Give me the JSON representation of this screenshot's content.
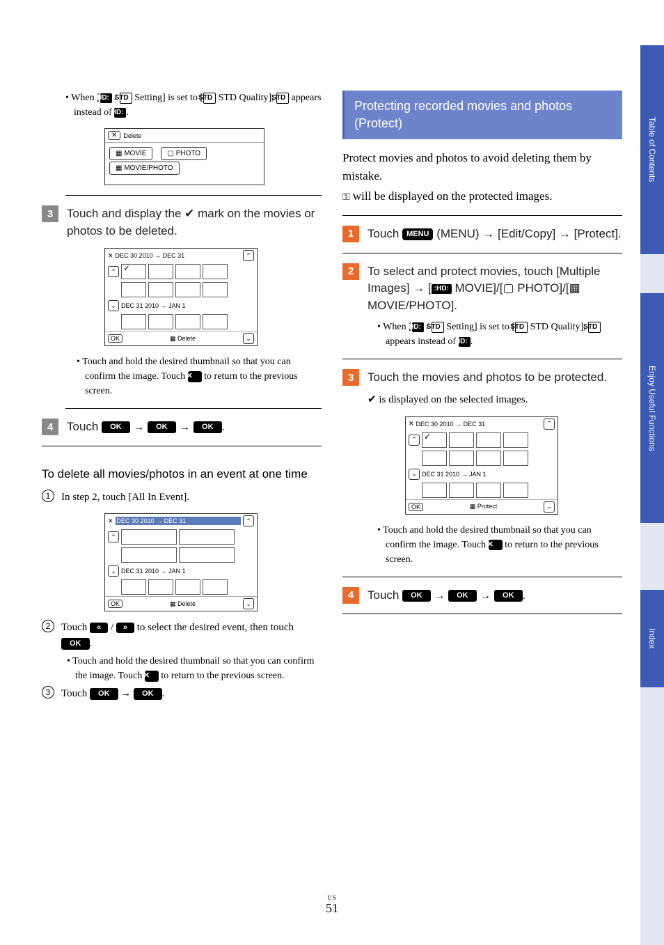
{
  "sidebar": {
    "toc": "Table of Contents",
    "useful": "Enjoy Useful Functions",
    "index": "Index"
  },
  "badges": {
    "hd": "HD",
    "std": "STD",
    "menu": "MENU",
    "ok": "OK",
    "x": "✕",
    "up": "«",
    "down": "»"
  },
  "left": {
    "intro_note": "When [  /  Setting] is set to [ STD Quality],  appears instead of .",
    "intro_pre": "When [",
    "intro_mid1": " / ",
    "intro_mid2": " Setting] is set to [",
    "intro_mid3": " STD Quality], ",
    "intro_mid4": " appears instead of ",
    "delete_screen": {
      "title": "Delete",
      "movie": "MOVIE",
      "photo": "PHOTO",
      "moviephoto": "MOVIE/PHOTO"
    },
    "step3": "Touch and display the ✔ mark on the movies or photos to be deleted.",
    "thumb1": {
      "h1": "DEC 30 2010 → DEC 31",
      "h2": "DEC 31 2010 → JAN 1",
      "footer": "Delete"
    },
    "step3_note_a": "Touch and hold the desired thumbnail so that you can confirm the image. Touch ",
    "step3_note_b": " to return to the previous screen.",
    "step4_pre": "Touch ",
    "subhead": "To delete all movies/photos in an event at one time",
    "c1": "In step 2, touch [All In Event].",
    "thumb2": {
      "h1": "DEC 30 2010 → DEC 31",
      "h2": "DEC 31 2010 → JAN 1",
      "footer": "Delete"
    },
    "c2_a": "Touch ",
    "c2_b": " / ",
    "c2_c": " to select the desired event, then touch ",
    "c2_note_a": "Touch and hold the desired thumbnail so that you can confirm the image. Touch ",
    "c2_note_b": " to return to the previous screen.",
    "c3_a": "Touch ",
    "c3_b": " → "
  },
  "right": {
    "heading": "Protecting recorded movies and photos (Protect)",
    "p1": "Protect movies and photos to avoid deleting them by mistake.",
    "p2_a": " will be displayed on the protected images.",
    "key": "⚿",
    "step1_a": "Touch ",
    "step1_b": " (MENU) → [Edit/Copy] → [Protect].",
    "step2_a": "To select and protect movies, touch [Multiple Images] → [",
    "step2_b": " MOVIE]/[",
    "step2_c": " PHOTO]/[",
    "step2_d": " MOVIE/PHOTO].",
    "step2_note_pre": "When [",
    "step2_note_mid1": " / ",
    "step2_note_mid2": " Setting] is set to [",
    "step2_note_mid3": " STD Quality], ",
    "step2_note_mid4": " appears instead of ",
    "step3": "Touch the movies and photos to be protected.",
    "step3_sub": "✔ is displayed on the selected images.",
    "thumb": {
      "h1": "DEC 30 2010 → DEC 31",
      "h2": "DEC 31 2010 → JAN 1",
      "footer": "Protect"
    },
    "step3_note_a": "Touch and hold the desired thumbnail so that you can confirm the image. Touch ",
    "step3_note_b": " to return to the previous screen.",
    "step4_pre": "Touch "
  },
  "circled": {
    "one": "1",
    "two": "2",
    "three": "3"
  },
  "page": {
    "us": "US",
    "num": "51"
  }
}
